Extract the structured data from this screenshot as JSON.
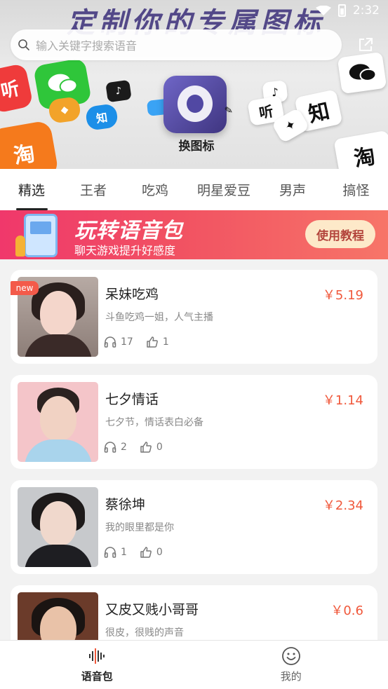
{
  "status_bar": {
    "time": "2:32"
  },
  "banner": {
    "headline": "定制你的专属图标",
    "app_label": "换图标",
    "tiles": [
      "听",
      "知",
      "淘"
    ]
  },
  "search": {
    "placeholder": "输入关键字搜索语音"
  },
  "tabs": [
    {
      "label": "精选",
      "active": true
    },
    {
      "label": "王者",
      "active": false
    },
    {
      "label": "吃鸡",
      "active": false
    },
    {
      "label": "明星爱豆",
      "active": false
    },
    {
      "label": "男声",
      "active": false
    },
    {
      "label": "搞怪",
      "active": false
    }
  ],
  "promo": {
    "headline": "玩转语音包",
    "subtitle": "聊天游戏提升好感度",
    "button_label": "使用教程"
  },
  "items": [
    {
      "title": "呆妹吃鸡",
      "price": "￥5.19",
      "description": "斗鱼吃鸡一姐，人气主播",
      "listens": "17",
      "likes": "1",
      "badge": "new"
    },
    {
      "title": "七夕情话",
      "price": "￥1.14",
      "description": "七夕节，情话表白必备",
      "listens": "2",
      "likes": "0",
      "badge": ""
    },
    {
      "title": "蔡徐坤",
      "price": "￥2.34",
      "description": "我的眼里都是你",
      "listens": "1",
      "likes": "0",
      "badge": ""
    },
    {
      "title": "又皮又贱小哥哥",
      "price": "￥0.6",
      "description": "很皮，很贱的声音",
      "listens": "",
      "likes": "",
      "badge": ""
    }
  ],
  "bottom_nav": [
    {
      "label": "语音包",
      "icon": "sound-wave-icon",
      "active": true
    },
    {
      "label": "我的",
      "icon": "smiley-icon",
      "active": false
    }
  ],
  "colors": {
    "price": "#f0583b",
    "promo_start": "#f0386b",
    "promo_end": "#f77568",
    "badge": "#f35a4a"
  }
}
